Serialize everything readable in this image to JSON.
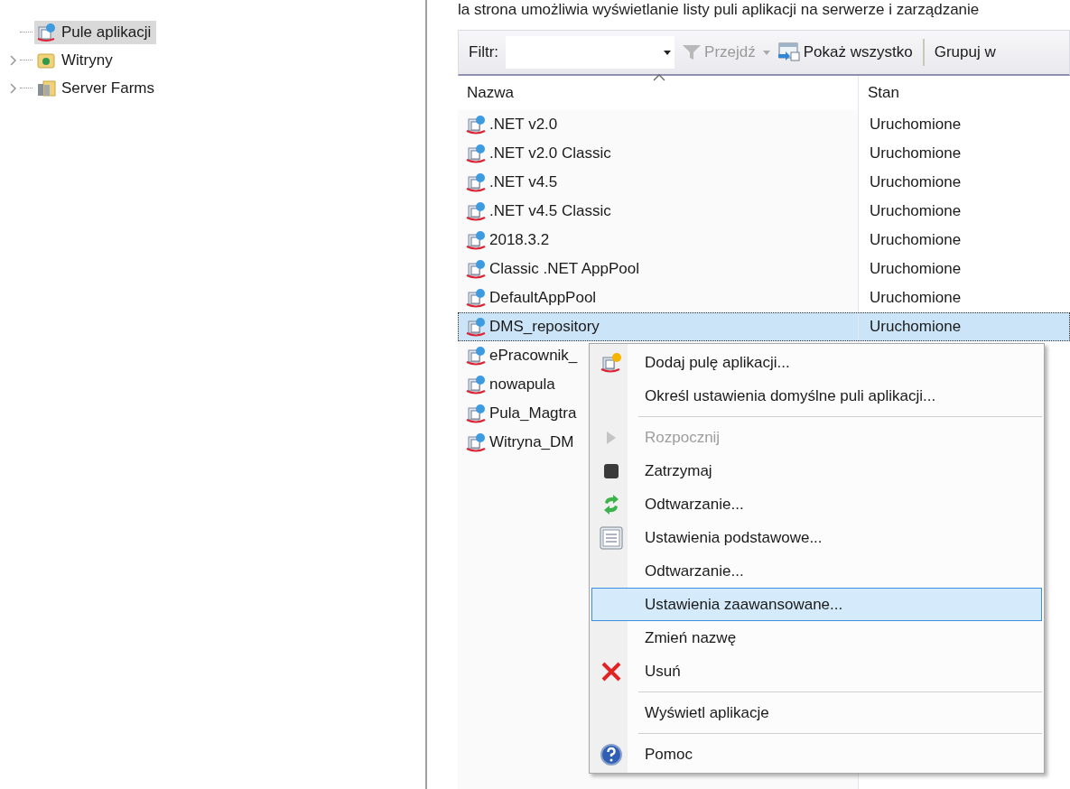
{
  "tree": [
    {
      "label": "Pule aplikacji",
      "expandable": false,
      "selected": true
    },
    {
      "label": "Witryny",
      "expandable": true,
      "selected": false
    },
    {
      "label": "Server Farms",
      "expandable": true,
      "selected": false
    }
  ],
  "description": "la strona umożliwia wyświetlanie listy puli aplikacji na serwerze i zarządzanie",
  "toolbar": {
    "filter_label": "Filtr:",
    "go": {
      "label": "Przejdź",
      "disabled": true
    },
    "show_all": "Pokaż wszystko",
    "group_by": "Grupuj w"
  },
  "table": {
    "columns": [
      "Nazwa",
      "Stan"
    ],
    "rows": [
      {
        "name": ".NET v2.0",
        "state": "Uruchomione",
        "selected": false
      },
      {
        "name": ".NET v2.0 Classic",
        "state": "Uruchomione",
        "selected": false
      },
      {
        "name": ".NET v4.5",
        "state": "Uruchomione",
        "selected": false
      },
      {
        "name": ".NET v4.5 Classic",
        "state": "Uruchomione",
        "selected": false
      },
      {
        "name": "2018.3.2",
        "state": "Uruchomione",
        "selected": false
      },
      {
        "name": "Classic .NET AppPool",
        "state": "Uruchomione",
        "selected": false
      },
      {
        "name": "DefaultAppPool",
        "state": "Uruchomione",
        "selected": false
      },
      {
        "name": "DMS_repository",
        "state": "Uruchomione",
        "selected": true
      },
      {
        "name": "ePracownik_",
        "selected": false
      },
      {
        "name": "nowapula",
        "selected": false
      },
      {
        "name": "Pula_Magtra",
        "selected": false
      },
      {
        "name": "Witryna_DM",
        "selected": false
      }
    ]
  },
  "context_menu": [
    {
      "kind": "item",
      "label": "Dodaj pulę aplikacji...",
      "disabled": false,
      "selected": false
    },
    {
      "kind": "item",
      "label": "Określ ustawienia domyślne puli aplikacji...",
      "disabled": false,
      "selected": false
    },
    {
      "kind": "separator"
    },
    {
      "kind": "item",
      "label": "Rozpocznij",
      "disabled": true,
      "selected": false
    },
    {
      "kind": "item",
      "label": "Zatrzymaj",
      "disabled": false,
      "selected": false
    },
    {
      "kind": "item",
      "label": "Odtwarzanie...",
      "disabled": false,
      "selected": false
    },
    {
      "kind": "item",
      "label": "Ustawienia podstawowe...",
      "disabled": false,
      "selected": false
    },
    {
      "kind": "item",
      "label": "Odtwarzanie...",
      "disabled": false,
      "selected": false
    },
    {
      "kind": "item",
      "label": "Ustawienia zaawansowane...",
      "disabled": false,
      "selected": true
    },
    {
      "kind": "item",
      "label": "Zmień nazwę",
      "disabled": false,
      "selected": false
    },
    {
      "kind": "item",
      "label": "Usuń",
      "disabled": false,
      "selected": false
    },
    {
      "kind": "separator"
    },
    {
      "kind": "item",
      "label": "Wyświetl aplikacje",
      "disabled": false,
      "selected": false
    },
    {
      "kind": "separator"
    },
    {
      "kind": "item",
      "label": "Pomoc",
      "disabled": false,
      "selected": false
    }
  ]
}
